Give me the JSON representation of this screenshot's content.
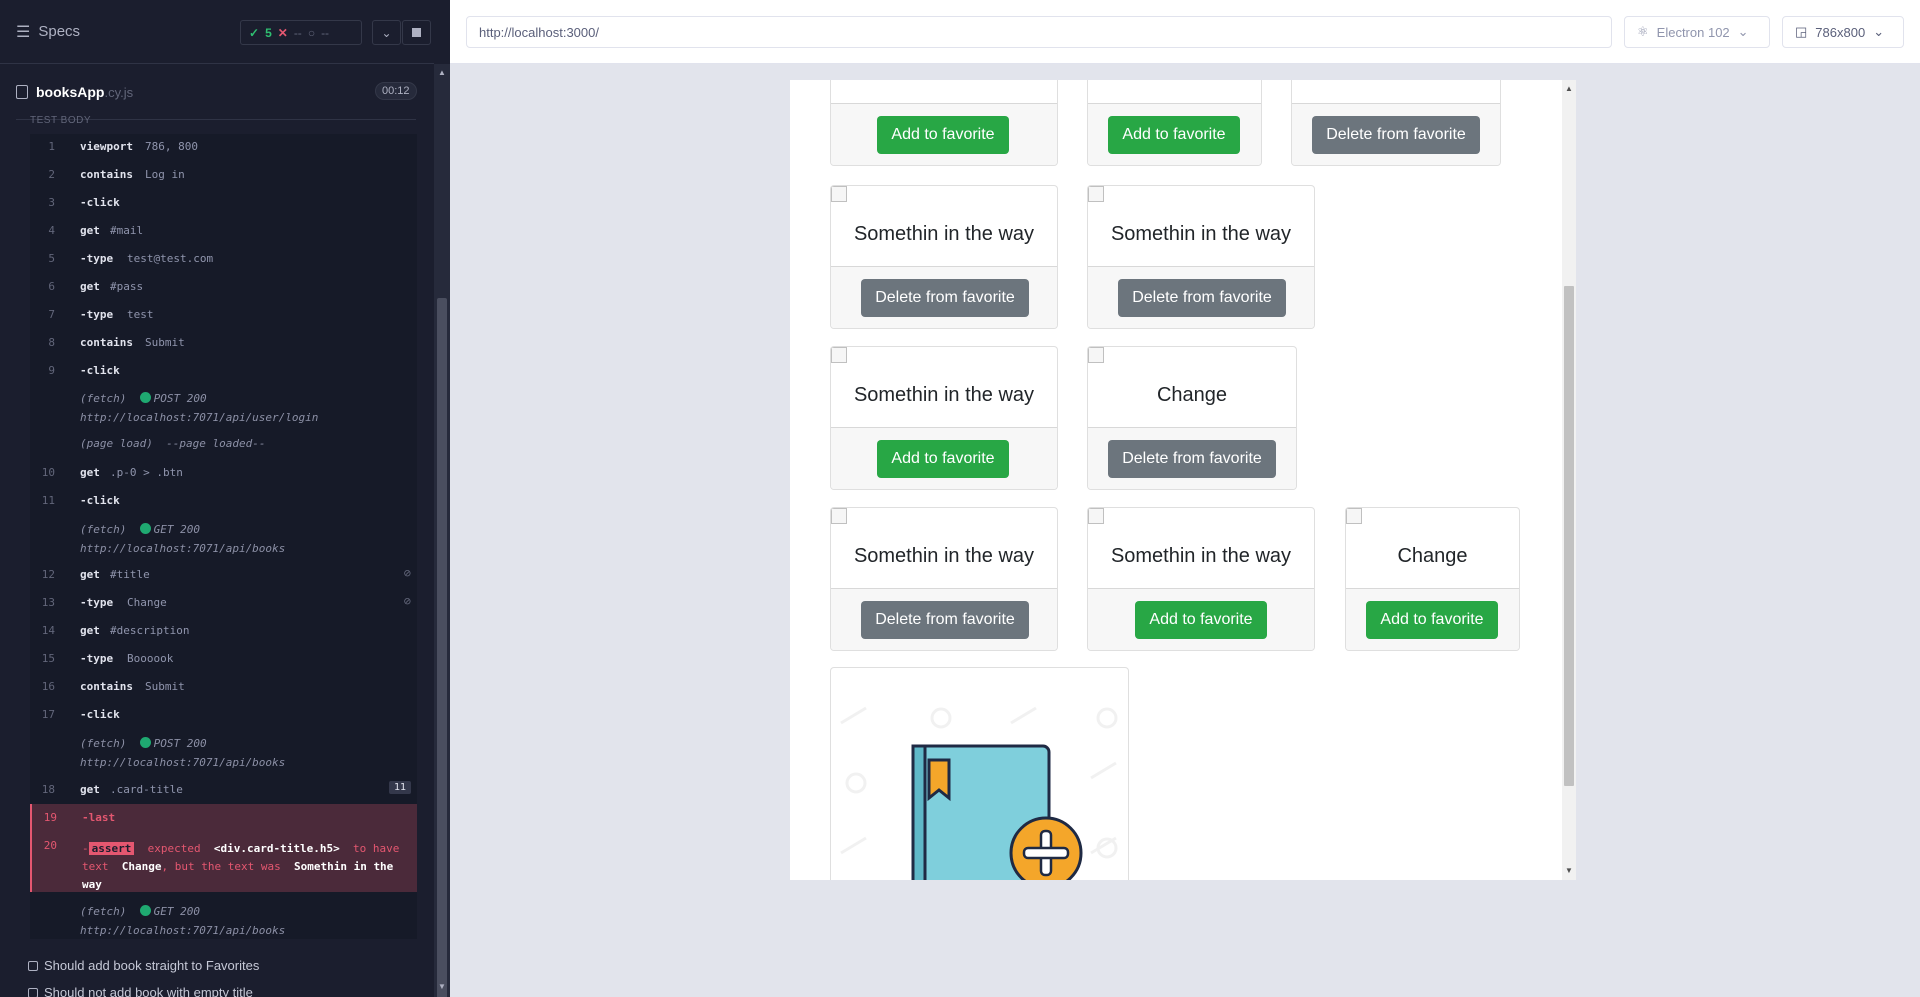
{
  "reporter": {
    "specs_label": "Specs",
    "stats": {
      "passed": "5",
      "failed": "--",
      "pending": "--"
    },
    "spec_file": {
      "name": "booksApp",
      "ext": ".cy.js",
      "duration": "00:12"
    },
    "test_body_label": "TEST BODY",
    "commands": [
      {
        "num": "1",
        "name": "viewport",
        "msg": "786, 800"
      },
      {
        "num": "2",
        "name": "contains",
        "msg": "Log in"
      },
      {
        "num": "3",
        "name": "-click",
        "msg": ""
      },
      {
        "num": "4",
        "name": "get",
        "msg": "#mail"
      },
      {
        "num": "5",
        "name": "-type",
        "msg": "test@test.com"
      },
      {
        "num": "6",
        "name": "get",
        "msg": "#pass"
      },
      {
        "num": "7",
        "name": "-type",
        "msg": "test"
      },
      {
        "num": "8",
        "name": "contains",
        "msg": "Submit"
      },
      {
        "num": "9",
        "name": "-click",
        "msg": ""
      },
      {
        "num": "10",
        "name": "get",
        "msg": ".p-0 > .btn"
      },
      {
        "num": "11",
        "name": "-click",
        "msg": ""
      },
      {
        "num": "12",
        "name": "get",
        "msg": "#title"
      },
      {
        "num": "13",
        "name": "-type",
        "msg": "Change"
      },
      {
        "num": "14",
        "name": "get",
        "msg": "#description"
      },
      {
        "num": "15",
        "name": "-type",
        "msg": "Boooook"
      },
      {
        "num": "16",
        "name": "contains",
        "msg": "Submit"
      },
      {
        "num": "17",
        "name": "-click",
        "msg": ""
      },
      {
        "num": "18",
        "name": "get",
        "msg": ".card-title",
        "badge": "11"
      },
      {
        "num": "19",
        "name": "-last",
        "msg": ""
      },
      {
        "num": "20",
        "name": "-assert",
        "msg": ""
      }
    ],
    "fetches": {
      "f1": {
        "type": "(fetch)",
        "method": "POST 200",
        "url": "http://localhost:7071/api/user/login"
      },
      "page_load": {
        "type": "(page load)",
        "msg": "--page loaded--"
      },
      "f2": {
        "type": "(fetch)",
        "method": "GET 200",
        "url": "http://localhost:7071/api/books"
      },
      "f3": {
        "type": "(fetch)",
        "method": "POST 200",
        "url": "http://localhost:7071/api/books"
      },
      "f4": {
        "type": "(fetch)",
        "method": "GET 200",
        "url": "http://localhost:7071/api/books"
      }
    },
    "assertion": {
      "badge": "assert",
      "p1": "expected",
      "subject": "<div.card-title.h5>",
      "p2": "to have text",
      "expected": "Change",
      "p3": ", but the text was",
      "actual": "Somethin in the way"
    },
    "tests": [
      "Should add book straight to Favorites",
      "Should not add book with empty title"
    ]
  },
  "aut": {
    "url": "http://localhost:3000/",
    "browser": "Electron 102",
    "viewport": "786x800"
  },
  "books": {
    "row0": {
      "b1": "Add to favorite",
      "b2": "Add to favorite",
      "b3": "Delete from favorite"
    },
    "row1": {
      "t1": "Somethin in the way",
      "b1": "Delete from favorite",
      "t2": "Somethin in the way",
      "b2": "Delete from favorite"
    },
    "row2": {
      "t1": "Somethin in the way",
      "b1": "Add to favorite",
      "t2": "Change",
      "b2": "Delete from favorite"
    },
    "row3": {
      "t1": "Somethin in the way",
      "b1": "Delete from favorite",
      "t2": "Somethin in the way",
      "b2": "Add to favorite",
      "t3": "Change",
      "b3": "Add to favorite"
    }
  },
  "colors": {
    "success": "#28a745",
    "secondary": "#6c757d",
    "fail": "#e45770",
    "pass": "#2fbf71"
  },
  "icons": [
    "specs-icon",
    "check-icon",
    "x-icon",
    "spinner-icon",
    "chevron-down-icon",
    "stop-icon",
    "file-icon",
    "eye-slash-icon",
    "electron-icon",
    "viewport-icon",
    "book-add-icon"
  ]
}
